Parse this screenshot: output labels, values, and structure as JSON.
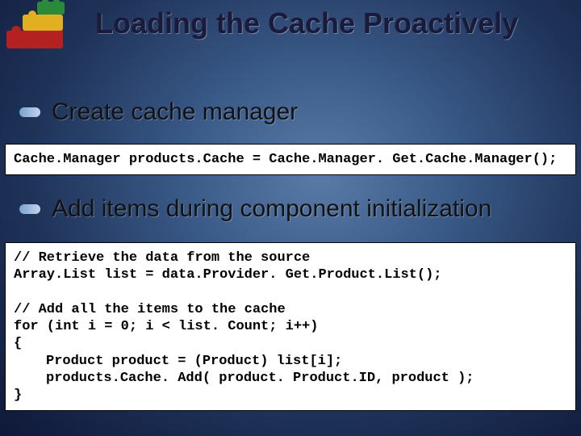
{
  "title": "Loading the Cache Proactively",
  "bullets": {
    "b1": "Create cache manager",
    "b2": "Add items during component initialization"
  },
  "code": {
    "c1": "Cache.Manager products.Cache = Cache.Manager. Get.Cache.Manager();",
    "c2_comment1": "// Retrieve the data from the source",
    "c2_line1": "Array.List list = data.Provider. Get.Product.List();",
    "c2_comment2": "// Add all the items to the cache",
    "c2_line2": "for (int i = 0; i < list. Count; i++)",
    "c2_brace_open": "{",
    "c2_body1": "Product product = (Product) list[i];",
    "c2_body2": "products.Cache. Add( product. Product.ID, product );",
    "c2_brace_close": "}"
  }
}
